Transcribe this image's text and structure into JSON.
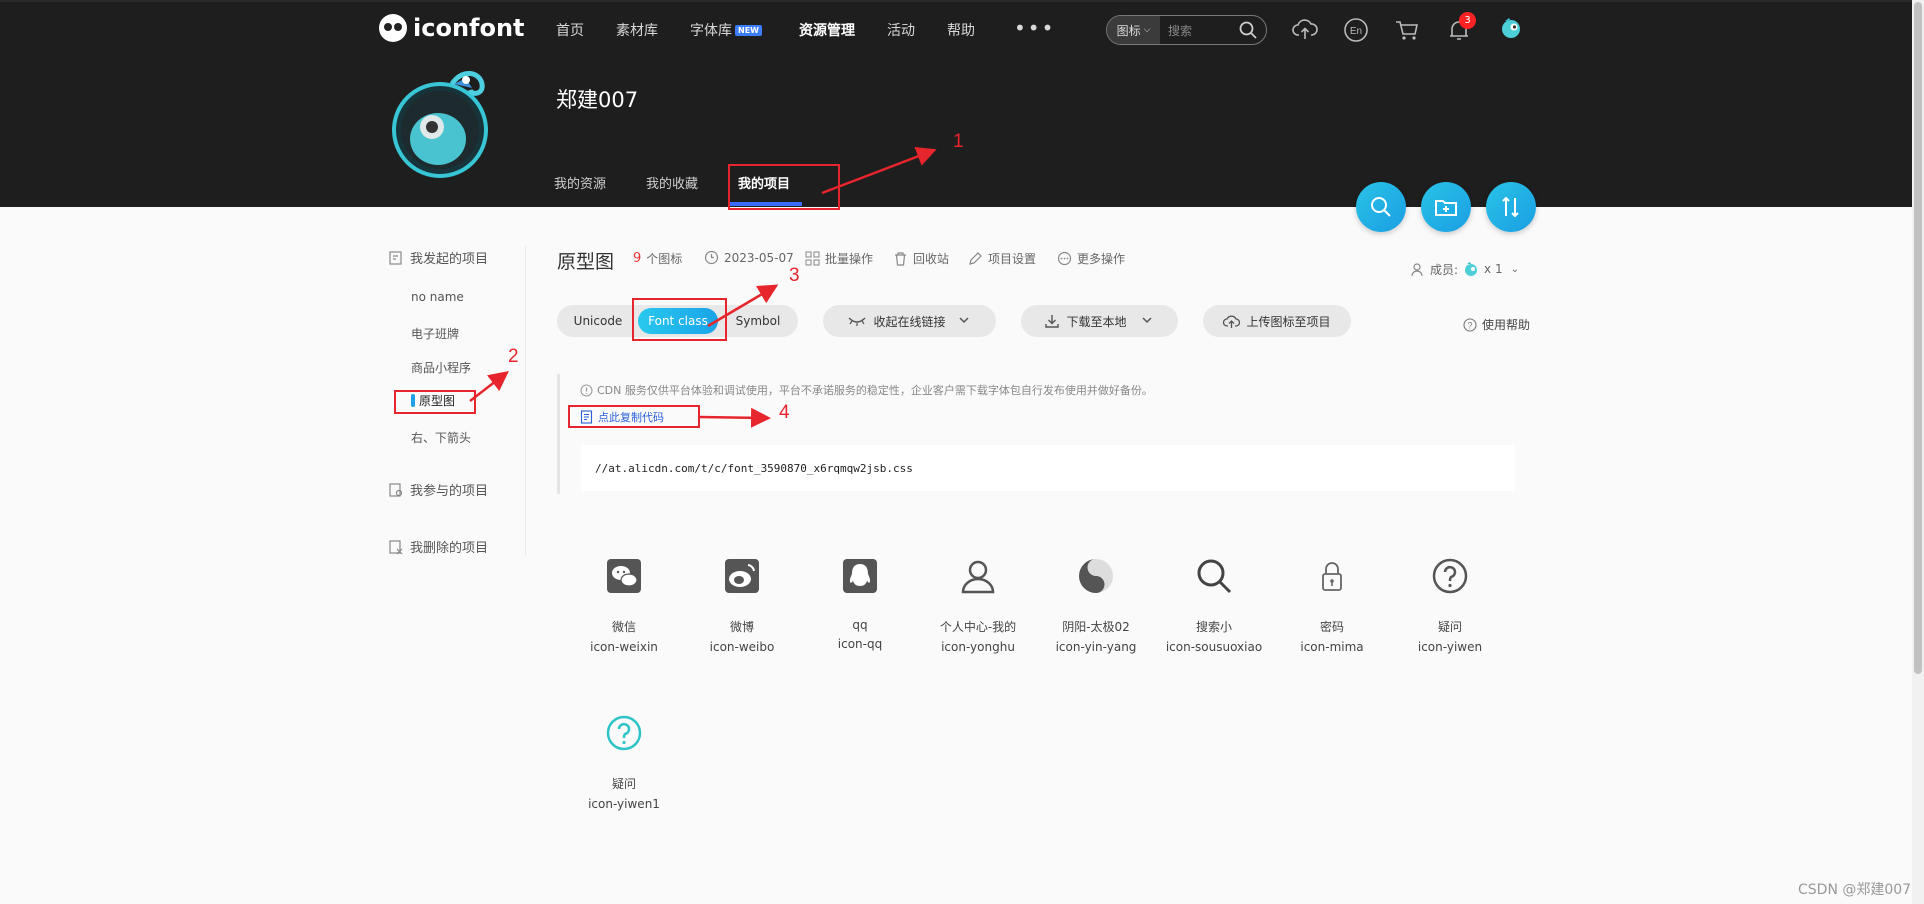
{
  "header": {
    "logo_text": "iconfont",
    "nav": [
      "首页",
      "素材库",
      "字体库",
      "资源管理",
      "活动",
      "帮助"
    ],
    "new_badge": "NEW",
    "more": "•••",
    "search": {
      "type": "图标",
      "placeholder": "搜索"
    },
    "notification_count": "3"
  },
  "profile": {
    "username": "郑建007",
    "tabs": [
      "我的资源",
      "我的收藏",
      "我的项目"
    ]
  },
  "sidebar": {
    "started_title": "我发起的项目",
    "items": [
      "no name",
      "电子班牌",
      "商品小程序",
      "原型图",
      "右、下箭头"
    ],
    "joined_title": "我参与的项目",
    "deleted_title": "我删除的项目"
  },
  "project": {
    "title": "原型图",
    "icon_count": "9",
    "icon_count_label": "个图标",
    "date": "2023-05-07",
    "actions": [
      "批量操作",
      "回收站",
      "项目设置",
      "更多操作"
    ],
    "members_label": "成员:",
    "members_count": "x 1"
  },
  "toolbar": {
    "formats": [
      "Unicode",
      "Font class",
      "Symbol"
    ],
    "collapse_link": "收起在线链接",
    "download": "下载至本地",
    "upload": "上传图标至项目",
    "help": "使用帮助"
  },
  "cdn": {
    "note": "CDN 服务仅供平台体验和调试使用，平台不承诺服务的稳定性，企业客户需下载字体包自行发布使用并做好备份。",
    "copy_code": "点此复制代码",
    "url": "//at.alicdn.com/t/c/font_3590870_x6rqmqw2jsb.css"
  },
  "icons": [
    {
      "name": "微信",
      "cls": "icon-weixin",
      "icon": "wechat-icon"
    },
    {
      "name": "微博",
      "cls": "icon-weibo",
      "icon": "weibo-icon"
    },
    {
      "name": "qq",
      "cls": "icon-qq",
      "icon": "qq-icon"
    },
    {
      "name": "个人中心-我的",
      "cls": "icon-yonghu",
      "icon": "user-icon"
    },
    {
      "name": "阴阳-太极02",
      "cls": "icon-yin-yang",
      "icon": "yin-yang-icon"
    },
    {
      "name": "搜索小",
      "cls": "icon-sousuoxiao",
      "icon": "search-icon"
    },
    {
      "name": "密码",
      "cls": "icon-mima",
      "icon": "lock-icon"
    },
    {
      "name": "疑问",
      "cls": "icon-yiwen",
      "icon": "question-icon"
    },
    {
      "name": "疑问",
      "cls": "icon-yiwen1",
      "icon": "question-icon-teal"
    }
  ],
  "annotations": [
    "1",
    "2",
    "3",
    "4"
  ],
  "watermark": "CSDN @郑建007",
  "colors": {
    "accent": "#1ea6e8",
    "annotation": "#e6252c",
    "header_bg": "#1e1e1e"
  }
}
